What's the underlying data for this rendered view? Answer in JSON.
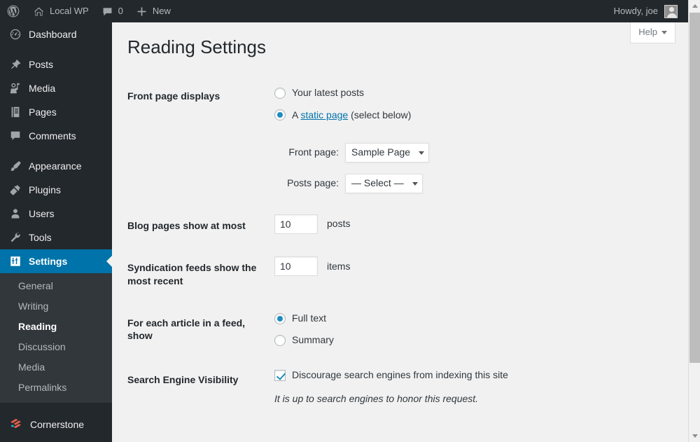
{
  "adminbar": {
    "site_name": "Local WP",
    "comment_count": "0",
    "new_label": "New",
    "howdy": "Howdy, joe",
    "wp_logo_icon": "wordpress-logo-icon",
    "home_icon": "home-icon",
    "comment_icon": "comment-bubble-icon",
    "plus_icon": "plus-icon",
    "avatar_icon": "user-avatar-icon"
  },
  "sidebar": {
    "items": [
      {
        "label": "Dashboard",
        "icon": "dashboard-icon"
      },
      {
        "label": "Posts",
        "icon": "pin-icon"
      },
      {
        "label": "Media",
        "icon": "media-icon"
      },
      {
        "label": "Pages",
        "icon": "page-icon"
      },
      {
        "label": "Comments",
        "icon": "comment-bubble-icon"
      },
      {
        "label": "Appearance",
        "icon": "paintbrush-icon"
      },
      {
        "label": "Plugins",
        "icon": "plug-icon"
      },
      {
        "label": "Users",
        "icon": "user-icon"
      },
      {
        "label": "Tools",
        "icon": "wrench-icon"
      },
      {
        "label": "Settings",
        "icon": "settings-sliders-icon"
      }
    ],
    "submenu": [
      {
        "label": "General"
      },
      {
        "label": "Writing"
      },
      {
        "label": "Reading"
      },
      {
        "label": "Discussion"
      },
      {
        "label": "Media"
      },
      {
        "label": "Permalinks"
      }
    ],
    "cornerstone": {
      "label": "Cornerstone",
      "icon": "cornerstone-icon"
    },
    "current_item": "Settings",
    "current_subitem": "Reading",
    "accent_color": "#0073aa"
  },
  "content": {
    "help_label": "Help",
    "page_title": "Reading Settings"
  },
  "settings": {
    "front_page_displays": {
      "label": "Front page displays",
      "options": [
        {
          "label": "Your latest posts",
          "checked": false
        },
        {
          "label": "A ",
          "link": "static page",
          "suffix": " (select below)",
          "checked": true
        }
      ],
      "front_page": {
        "label": "Front page:",
        "value": "Sample Page"
      },
      "posts_page": {
        "label": "Posts page:",
        "value": "— Select —"
      }
    },
    "blog_pages": {
      "label": "Blog pages show at most",
      "value": "10",
      "unit": "posts"
    },
    "syndication_feeds": {
      "label": "Syndication feeds show the most recent",
      "value": "10",
      "unit": "items"
    },
    "feed_article": {
      "label": "For each article in a feed, show",
      "options": [
        {
          "label": "Full text",
          "checked": true
        },
        {
          "label": "Summary",
          "checked": false
        }
      ]
    },
    "search_engine_visibility": {
      "label": "Search Engine Visibility",
      "checkbox_label": "Discourage search engines from indexing this site",
      "checked": true,
      "description": "It is up to search engines to honor this request."
    }
  }
}
